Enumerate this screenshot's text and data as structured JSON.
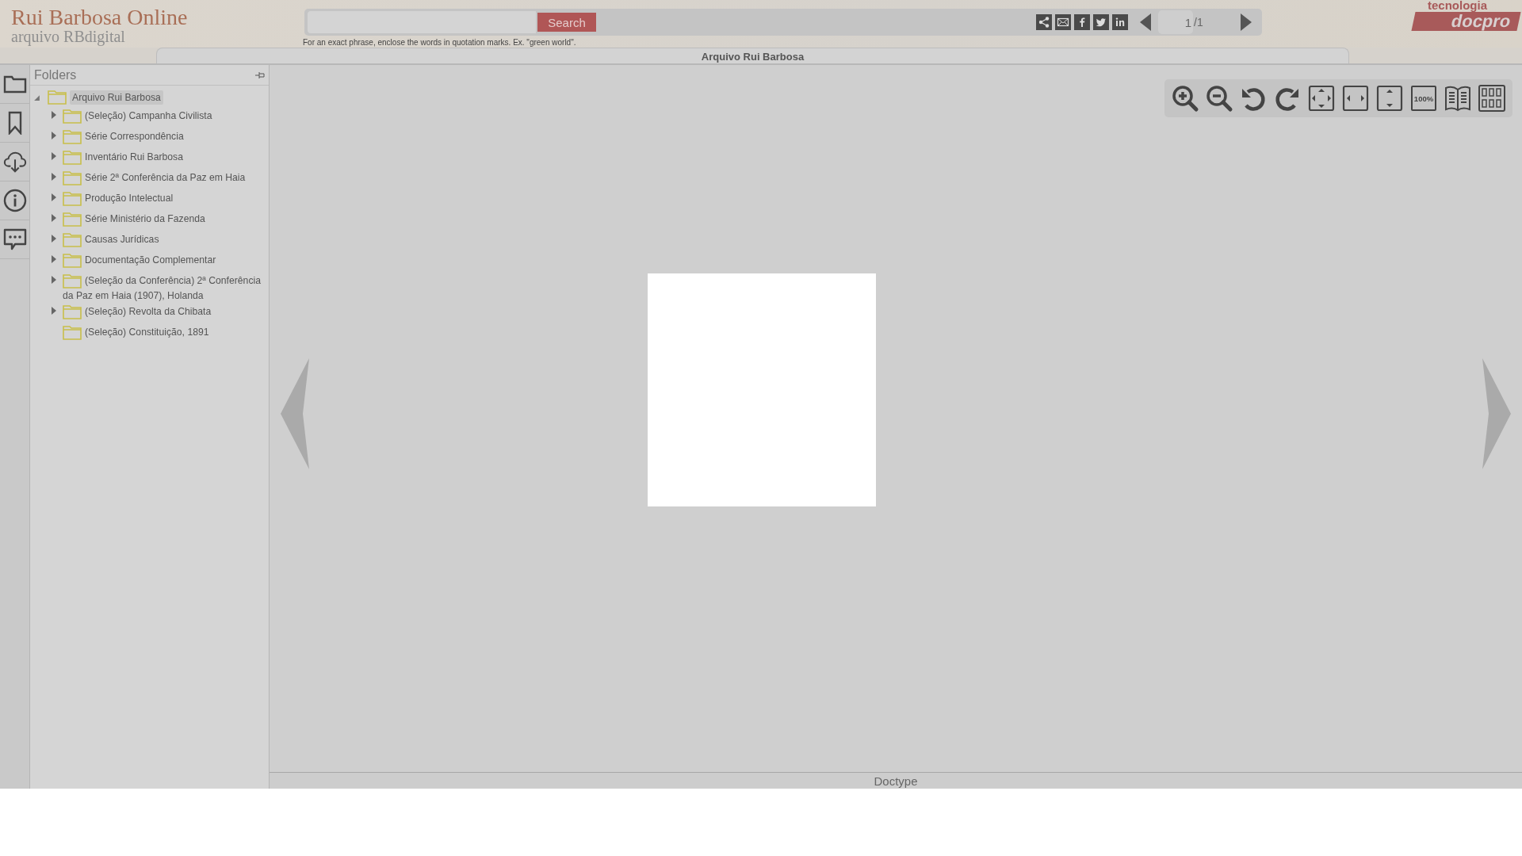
{
  "header": {
    "logo_title": "Rui Barbosa Online",
    "logo_subtitle": "arquivo RBdigital",
    "search": {
      "button": "Search",
      "hint": "For an exact phrase, enclose the words in quotation marks. Ex. \"green world\"."
    },
    "pager": {
      "current": "1",
      "total": "/1"
    },
    "brand": {
      "top": "tecnologia",
      "name": "docpro"
    }
  },
  "document_tab": "Arquivo Rui Barbosa",
  "folders": {
    "title": "Folders",
    "tree": {
      "label": "Arquivo Rui Barbosa",
      "expanded": true,
      "selected": true,
      "children": [
        {
          "label": "(Seleção) Campanha Civilista",
          "expandable": true
        },
        {
          "label": "Série Correspondência",
          "expandable": true
        },
        {
          "label": "Inventário Rui Barbosa",
          "expandable": true
        },
        {
          "label": "Série 2ª Conferência da Paz em Haia",
          "expandable": true
        },
        {
          "label": "Produção Intelectual",
          "expandable": true
        },
        {
          "label": "Série Ministério da Fazenda",
          "expandable": true
        },
        {
          "label": "Causas Jurídicas",
          "expandable": true
        },
        {
          "label": "Documentação Complementar",
          "expandable": true
        },
        {
          "label": "(Seleção da Conferência) 2ª Conferência da Paz em Haia (1907), Holanda",
          "expandable": true
        },
        {
          "label": "(Seleção) Revolta da Chibata",
          "expandable": true
        },
        {
          "label": "(Seleção) Constituição, 1891",
          "expandable": false
        }
      ]
    }
  },
  "viewer": {
    "actual_size_label": "100%"
  },
  "status_bar": "Doctype"
}
